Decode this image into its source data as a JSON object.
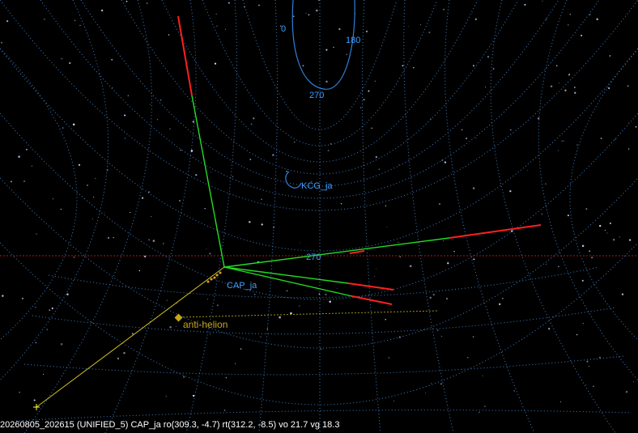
{
  "labels": {
    "grid_0": "0",
    "grid_180": "180",
    "grid_270": "270",
    "grid_270_lower": "270",
    "radiant": "KCG_ja",
    "shower": "CAP_ja",
    "anti_helion": "anti-helion"
  },
  "status_line": "20260805_202615 (UNIFIED_5) CAP_ja ro(309.3, -4.7) rt(312.2, -8.5) vo 21.7 vg 18.3",
  "colors": {
    "background": "#000000",
    "grid": "#3f7fc4",
    "label": "#3ea0ff",
    "trail_green": "#22dd22",
    "trail_red": "#ff2020",
    "anti_helion": "#c8a41a",
    "horizon": "#b01818"
  }
}
